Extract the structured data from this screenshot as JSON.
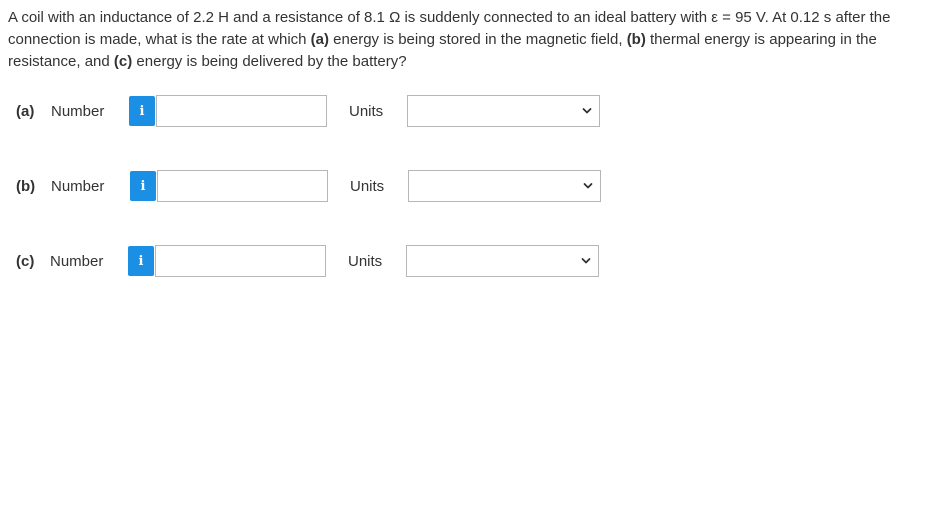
{
  "question": {
    "intro": "A coil with an inductance of 2.2 H and a resistance of 8.1 Ω is suddenly connected to an ideal battery with ε = 95 V. At 0.12 s after the connection is made, what is the rate at which ",
    "part_a_tag": "(a)",
    "part_a_text": " energy is being stored in the magnetic field, ",
    "part_b_tag": "(b)",
    "part_b_text": " thermal energy is appearing in the resistance, and ",
    "part_c_tag": "(c)",
    "part_c_text": " energy is being delivered by the battery?"
  },
  "parts": [
    {
      "label": "(a)",
      "number_label": "Number",
      "info_icon": "i",
      "number_value": "",
      "units_label": "Units",
      "units_selected": ""
    },
    {
      "label": "(b)",
      "number_label": "Number",
      "info_icon": "i",
      "number_value": "",
      "units_label": "Units",
      "units_selected": ""
    },
    {
      "label": "(c)",
      "number_label": "Number",
      "info_icon": "i",
      "number_value": "",
      "units_label": "Units",
      "units_selected": ""
    }
  ],
  "colors": {
    "info_button": "#1a8fe3",
    "text": "#333333",
    "input_border": "#b7b7b7"
  },
  "icons": {
    "info": "info-icon",
    "dropdown": "chevron-down-icon"
  }
}
